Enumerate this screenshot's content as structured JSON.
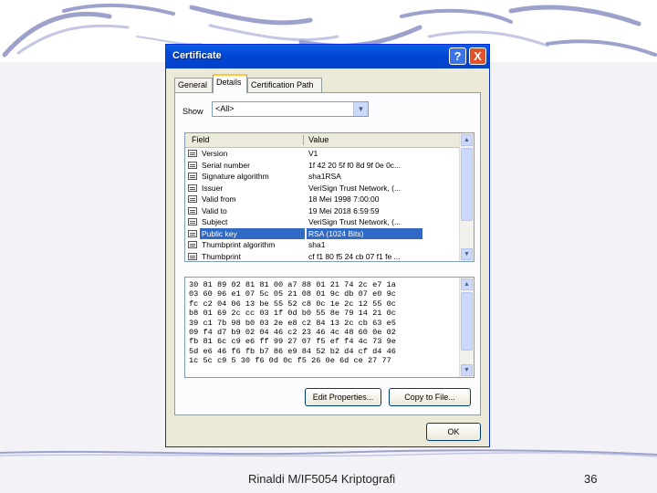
{
  "slide": {
    "footer": "Rinaldi M/IF5054 Kriptografi",
    "page_number": "36"
  },
  "dialog": {
    "title": "Certificate",
    "help_glyph": "?",
    "close_glyph": "X",
    "tabs": [
      {
        "label": "General"
      },
      {
        "label": "Details"
      },
      {
        "label": "Certification Path"
      }
    ],
    "active_tab": "Details",
    "show_label": "Show",
    "show_value": "<All>",
    "list": {
      "columns": [
        "Field",
        "Value"
      ],
      "rows": [
        {
          "field": "Version",
          "value": "V1"
        },
        {
          "field": "Serial number",
          "value": "1f 42 20 5f f0 8d 9f 0e 0c..."
        },
        {
          "field": "Signature algorithm",
          "value": "sha1RSA"
        },
        {
          "field": "Issuer",
          "value": "VeriSign Trust Network, (..."
        },
        {
          "field": "Valid from",
          "value": "18 Mei 1998 7:00:00"
        },
        {
          "field": "Valid to",
          "value": "19 Mei 2018 6:59:59"
        },
        {
          "field": "Subject",
          "value": "VeriSign Trust Network, (..."
        },
        {
          "field": "Public key",
          "value": "RSA (1024 Bits)"
        },
        {
          "field": "Thumbprint algorithm",
          "value": "sha1"
        },
        {
          "field": "Thumbprint",
          "value": "cf f1 80 f5 24 cb 07 f1 fe ..."
        }
      ],
      "selected": "Public key"
    },
    "hex_lines": [
      "30 81 89 02 81 81 00 a7 88 01 21 74 2c e7 1a",
      "03 60 96 e1 07 5c 05 21 08 01 9c db 07 e0 9c",
      "fc c2 04 06 13 be 55 52 c8 0c 1e 2c 12 55 0c",
      "b8 01 69 2c cc 03 1f 0d b0 55 8e 79 14 21 0c",
      "39 c1 7b 98 b0 03 2e e8 c2 84 13 2c cb 63 e5",
      "09 f4 d7 b9 02 04 46 c2 23 46 4c 48 60 0e 02",
      "fb 81 6c c9 e6 ff 99 27 07 f5 ef f4 4c 73 9e",
      "5d e6 46 f6 fb b7 86 e9 84 52 b2 d4 cf d4 46",
      "1c 5c c9 5 30 f6 0d 0c f5 26 0e 6d ce 27 77"
    ],
    "buttons": {
      "edit_properties": "Edit Properties...",
      "copy_to_file": "Copy to File...",
      "ok": "OK"
    }
  },
  "colors": {
    "title_bar": "#0046d5",
    "selection": "#316ac5",
    "dialog_bg": "#ece9d8",
    "wave_accent": "#8a8fc0"
  }
}
